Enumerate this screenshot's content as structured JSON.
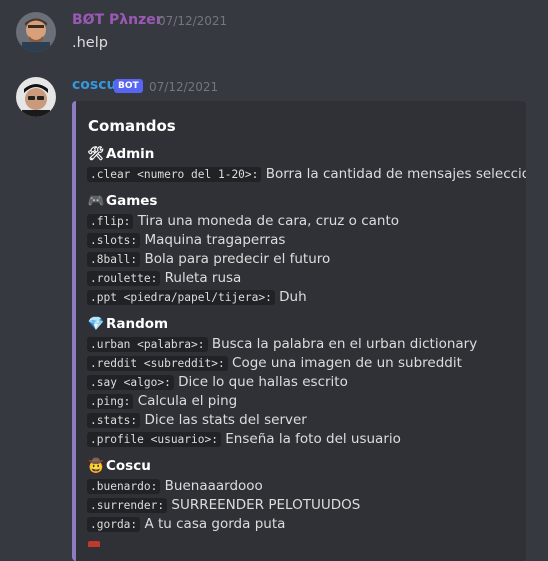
{
  "messages": [
    {
      "author": "BØT Pλnzer",
      "timestamp": "07/12/2021",
      "text": ".help"
    },
    {
      "author": "coscu",
      "bot_tag": "BOT",
      "timestamp": "07/12/2021",
      "embed": {
        "title": "Comandos",
        "sections": [
          {
            "icon": "hammer-wrench-icon",
            "emoji": "🛠",
            "title": "Admin",
            "commands": [
              {
                "cmd": ".clear <numero del 1-20>:",
                "desc": "Borra la cantidad de mensajes seleccionada"
              }
            ]
          },
          {
            "icon": "game-controller-icon",
            "emoji": "🎮",
            "title": "Games",
            "commands": [
              {
                "cmd": ".flip:",
                "desc": "Tira una moneda de cara, cruz o canto"
              },
              {
                "cmd": ".slots:",
                "desc": "Maquina tragaperras"
              },
              {
                "cmd": ".8ball:",
                "desc": "Bola para predecir el futuro"
              },
              {
                "cmd": ".roulette:",
                "desc": "Ruleta rusa"
              },
              {
                "cmd": ".ppt <piedra/papel/tijera>:",
                "desc": "Duh"
              }
            ]
          },
          {
            "icon": "gem-icon",
            "emoji": "💎",
            "title": "Random",
            "commands": [
              {
                "cmd": ".urban <palabra>:",
                "desc": "Busca la palabra en el urban dictionary"
              },
              {
                "cmd": ".reddit <subreddit>:",
                "desc": "Coge una imagen de un subreddit"
              },
              {
                "cmd": ".say <algo>:",
                "desc": "Dice lo que hallas escrito"
              },
              {
                "cmd": ".ping:",
                "desc": "Calcula el ping"
              },
              {
                "cmd": ".stats:",
                "desc": "Dice las stats del server"
              },
              {
                "cmd": ".profile <usuario>:",
                "desc": "Enseña la foto del usuario"
              }
            ]
          },
          {
            "icon": "cowboy-face-icon",
            "emoji": "🤠",
            "title": "Coscu",
            "commands": [
              {
                "cmd": ".buenardo:",
                "desc": "Buenaaardooo"
              },
              {
                "cmd": ".surrender:",
                "desc": "SURREENDER PELOTUUDOS"
              },
              {
                "cmd": ".gorda:",
                "desc": "A tu casa gorda puta"
              }
            ]
          }
        ]
      }
    }
  ],
  "colors": {
    "background": "#36393f",
    "embed_bg": "#2f3136",
    "embed_bar": "#8e7cc3",
    "author1": "#9b59b6",
    "author2": "#3498db",
    "bot_badge": "#5865f2"
  }
}
